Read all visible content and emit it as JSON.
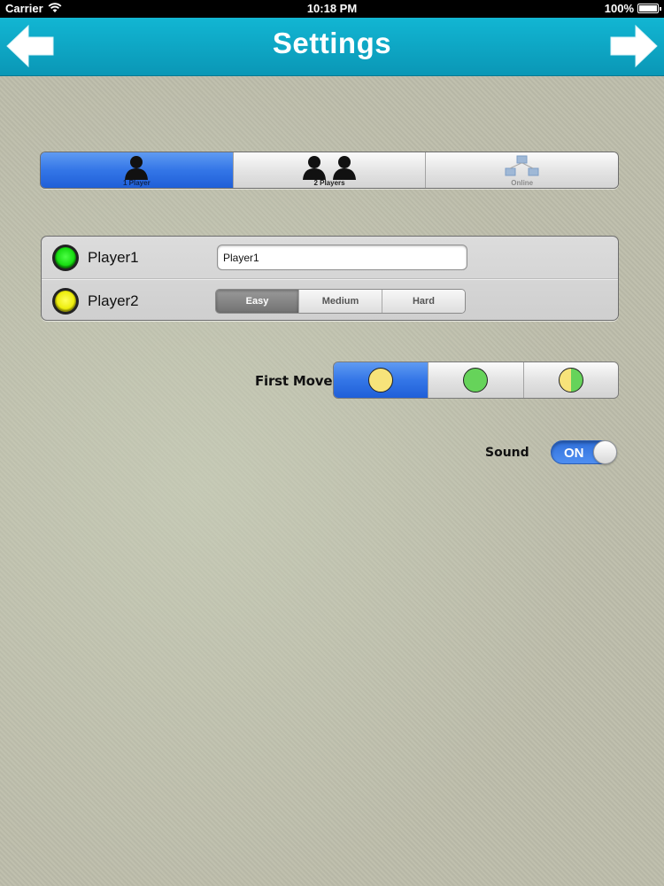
{
  "status_bar": {
    "carrier": "Carrier",
    "time": "10:18 PM",
    "battery": "100%"
  },
  "nav": {
    "title": "Settings",
    "back_icon": "arrow-left-icon",
    "forward_icon": "arrow-right-icon",
    "color": "#0aa7c6"
  },
  "mode_tabs": [
    {
      "label": "1 Player",
      "icon": "single-player-icon",
      "selected": true
    },
    {
      "label": "2 Players",
      "icon": "two-players-icon",
      "selected": false
    },
    {
      "label": "Online",
      "icon": "network-icon",
      "selected": false
    }
  ],
  "players": {
    "player1": {
      "name": "Player1",
      "color": "#22e016",
      "input_value": "Player1"
    },
    "player2": {
      "name": "Player2",
      "color": "#f2f20e",
      "difficulty": [
        "Easy",
        "Medium",
        "Hard"
      ],
      "selected_difficulty": "Easy"
    }
  },
  "first_move": {
    "label": "First Move",
    "options": [
      {
        "icon": "yellow-circle-icon",
        "color": "#f7e37a",
        "selected": true
      },
      {
        "icon": "green-circle-icon",
        "color": "#66d35a",
        "selected": false
      },
      {
        "icon": "half-yellow-green-circle-icon",
        "color": "#f7e37a",
        "color2": "#66d35a",
        "selected": false
      }
    ]
  },
  "sound": {
    "label": "Sound",
    "state": "ON",
    "accent": "#3a7ee6"
  }
}
